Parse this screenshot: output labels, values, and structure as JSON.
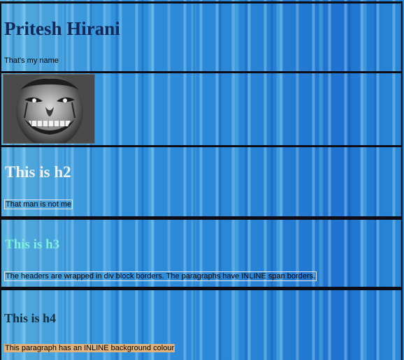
{
  "header": {
    "title": "Pritesh Hirani",
    "subtitle": "That's my name"
  },
  "image": {
    "icon": "clown-face-photo"
  },
  "section_h2": {
    "heading": "This is h2",
    "text": "That man is not me"
  },
  "section_h3": {
    "heading": "This is h3",
    "text": "The headers are wrapped in div block borders. The paragraphs have INLINE span borders."
  },
  "section_h4": {
    "heading": "This is h4",
    "text": "This paragraph has an INLINE background colour"
  },
  "colors": {
    "background": "#2a86d6",
    "h1": "#12275a",
    "h2": "#f1f1f1",
    "h3": "#7ef0dd",
    "h4": "#143040",
    "inline_bg": "#e0b37c",
    "block_border": "#0c0c14"
  }
}
